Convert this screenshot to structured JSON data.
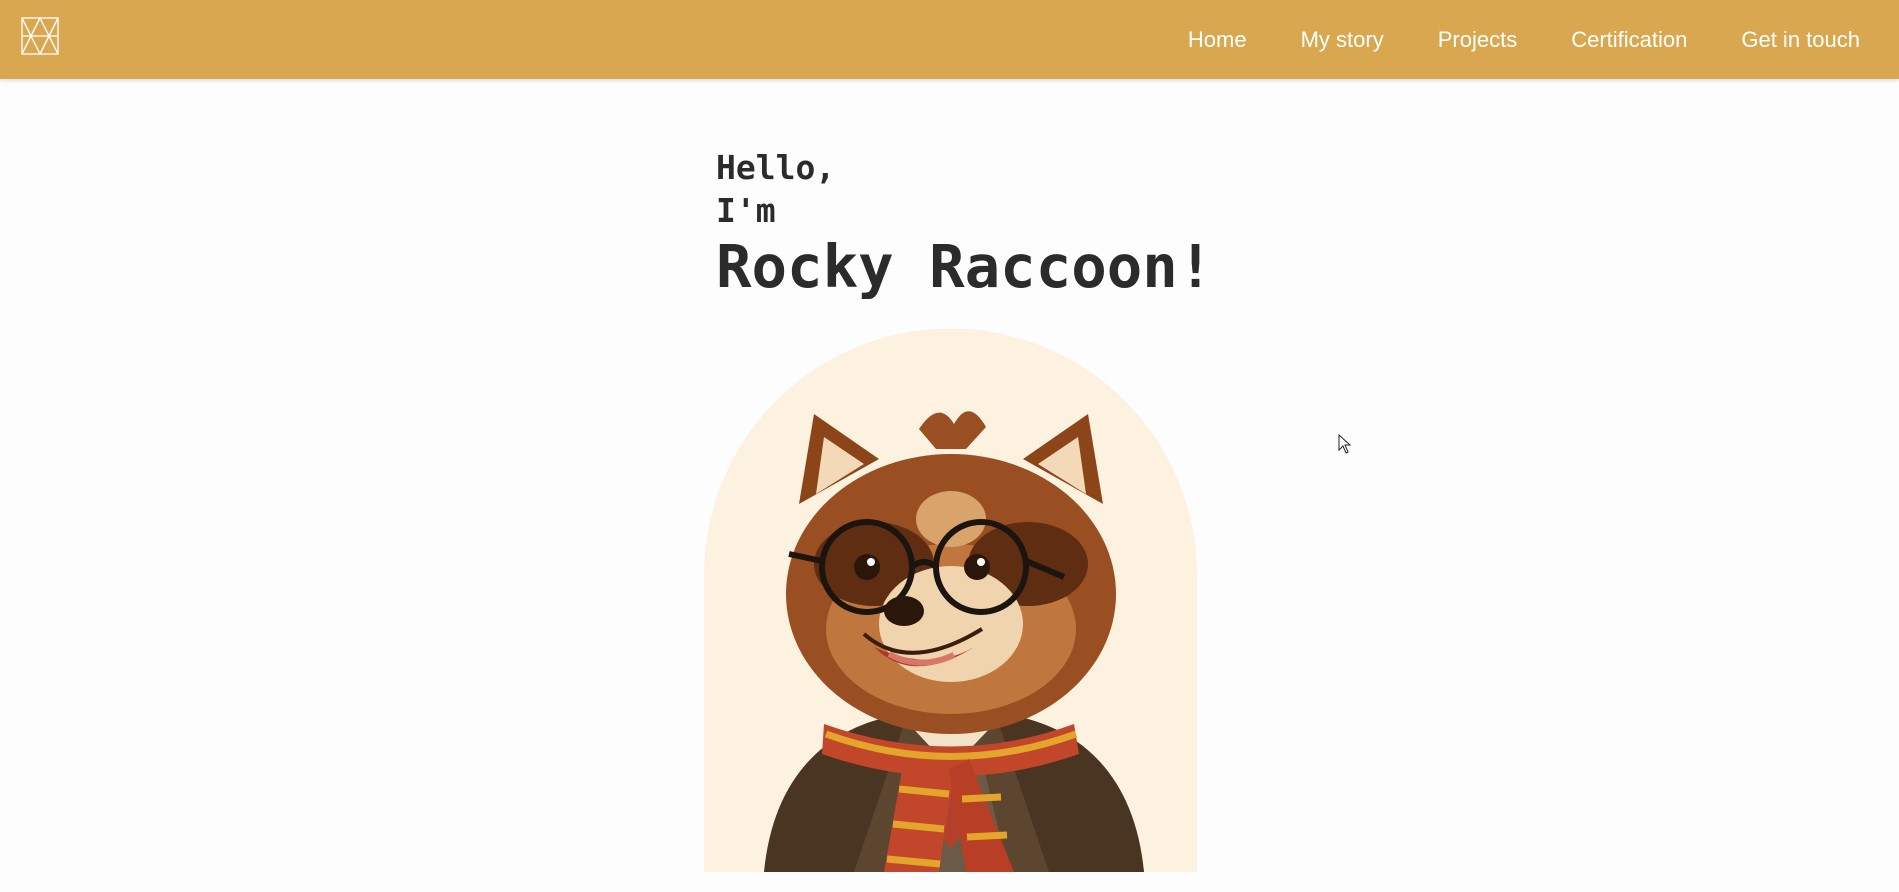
{
  "nav": {
    "logo_icon": "geometric-logo-icon",
    "links": [
      {
        "label": "Home"
      },
      {
        "label": "My story"
      },
      {
        "label": "Projects"
      },
      {
        "label": "Certification"
      },
      {
        "label": "Get in touch"
      }
    ]
  },
  "hero": {
    "line1": "Hello,",
    "line2": "I'm",
    "name": "Rocky Raccoon!"
  },
  "portrait": {
    "icon": "raccoon-portrait-illustration"
  },
  "colors": {
    "nav_bg": "#d9a74f",
    "nav_text": "#ffffff",
    "page_bg": "#fdfdfd",
    "heading_text": "#2b2b2b",
    "arch_bg": "#fdf1e0"
  }
}
